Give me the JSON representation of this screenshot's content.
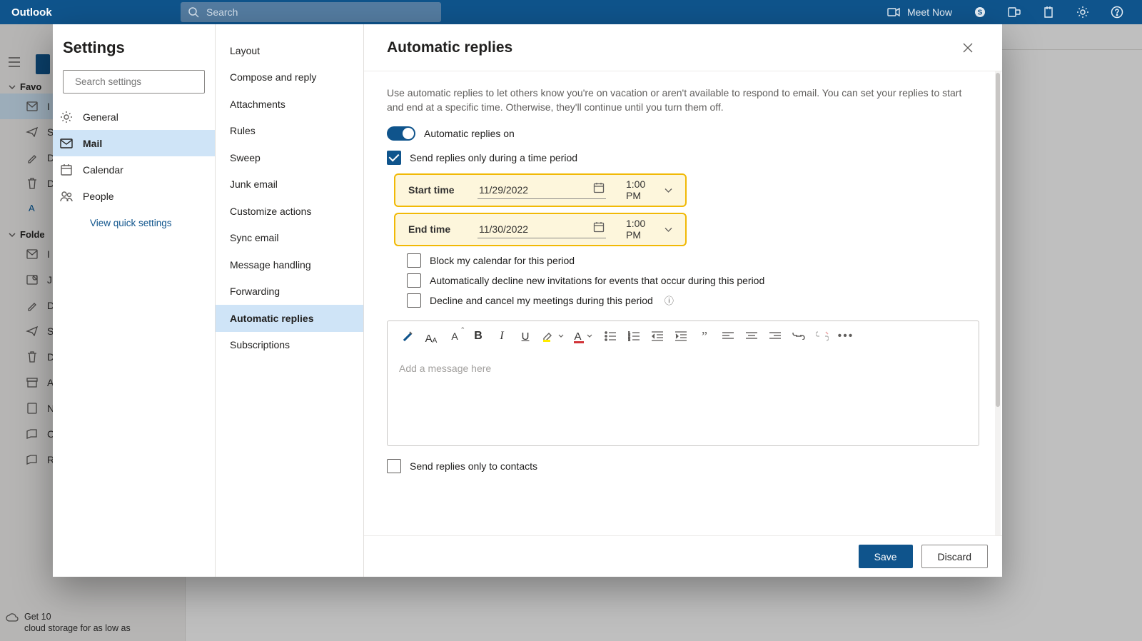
{
  "app": {
    "brand": "Outlook"
  },
  "search": {
    "placeholder": "Search"
  },
  "header_right": {
    "meet_now": "Meet Now"
  },
  "bg_nav": {
    "favorites": "Favo",
    "items1": [
      "I",
      "S",
      "D",
      "D"
    ],
    "add_fav": "A",
    "folders": "Folde",
    "items2": [
      "I",
      "J",
      "D",
      "S",
      "D",
      "A",
      "N",
      "C",
      "R"
    ],
    "upsell_line1": "Get 10",
    "upsell_line2": "cloud storage for as low as"
  },
  "settings": {
    "title": "Settings",
    "search_placeholder": "Search settings",
    "categories": [
      {
        "id": "general",
        "label": "General"
      },
      {
        "id": "mail",
        "label": "Mail"
      },
      {
        "id": "calendar",
        "label": "Calendar"
      },
      {
        "id": "people",
        "label": "People"
      }
    ],
    "quick_link": "View quick settings"
  },
  "mail_nav": [
    "Layout",
    "Compose and reply",
    "Attachments",
    "Rules",
    "Sweep",
    "Junk email",
    "Customize actions",
    "Sync email",
    "Message handling",
    "Forwarding",
    "Automatic replies",
    "Subscriptions"
  ],
  "pane": {
    "title": "Automatic replies",
    "intro": "Use automatic replies to let others know you're on vacation or aren't available to respond to email. You can set your replies to start and end at a specific time. Otherwise, they'll continue until you turn them off.",
    "toggle_label": "Automatic replies on",
    "chk_period": "Send replies only during a time period",
    "period": {
      "start_label": "Start time",
      "start_date": "11/29/2022",
      "start_time": "1:00 PM",
      "end_label": "End time",
      "end_date": "11/30/2022",
      "end_time": "1:00 PM"
    },
    "chk_block": "Block my calendar for this period",
    "chk_decline": "Automatically decline new invitations for events that occur during this period",
    "chk_cancel": "Decline and cancel my meetings during this period",
    "msg_placeholder": "Add a message here",
    "chk_contacts": "Send replies only to contacts",
    "save": "Save",
    "discard": "Discard"
  }
}
